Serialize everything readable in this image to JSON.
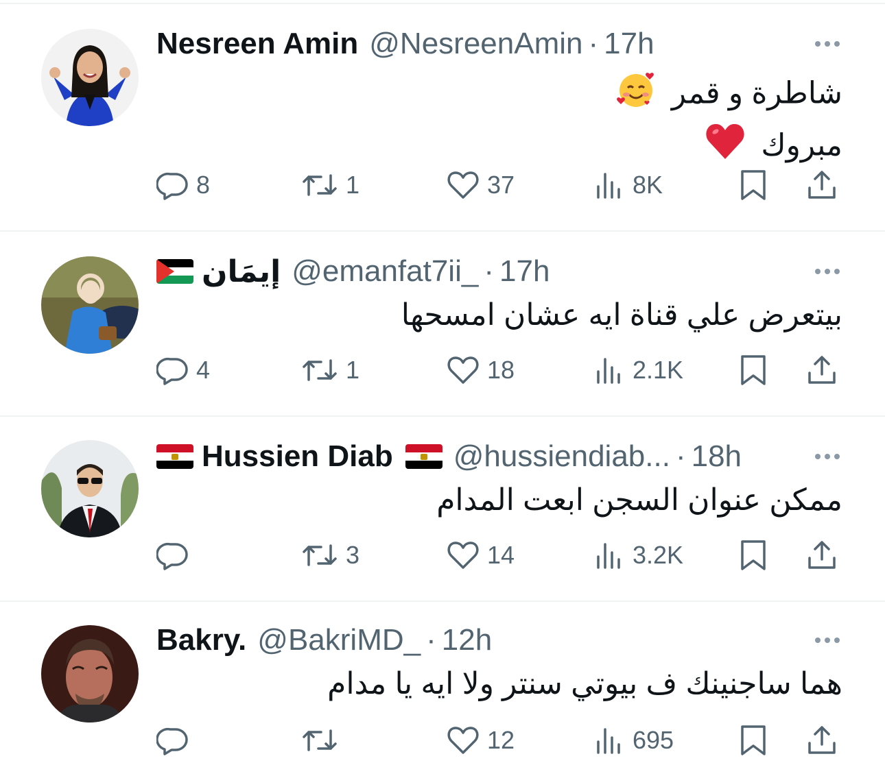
{
  "tweets": [
    {
      "display_name": "Nesreen Amin",
      "handle": "@NesreenAmin",
      "time": "17h",
      "flags_before": [],
      "flags_after": [],
      "lines": [
        "شاطرة و قمر",
        "مبروك"
      ],
      "line_emojis": [
        "smiling-face-with-hearts",
        "red-heart"
      ],
      "replies": "8",
      "reposts": "1",
      "likes": "37",
      "views": "8K"
    },
    {
      "display_name": "إيمَان",
      "handle": "@emanfat7ii_",
      "time": "17h",
      "flags_before": [
        "palestine"
      ],
      "flags_after": [],
      "lines": [
        "بيتعرض علي قناة ايه عشان امسحها"
      ],
      "line_emojis": [],
      "replies": "4",
      "reposts": "1",
      "likes": "18",
      "views": "2.1K"
    },
    {
      "display_name": "Hussien Diab",
      "handle": "@hussiendiab...",
      "time": "18h",
      "flags_before": [
        "egypt"
      ],
      "flags_after": [
        "egypt"
      ],
      "lines": [
        "ممكن عنوان السجن ابعت المدام"
      ],
      "line_emojis": [],
      "replies": "",
      "reposts": "3",
      "likes": "14",
      "views": "3.2K"
    },
    {
      "display_name": "Bakry.",
      "handle": "@BakriMD_",
      "time": "12h",
      "flags_before": [],
      "flags_after": [],
      "lines": [
        "هما ساجنينك ف بيوتي سنتر ولا ايه يا مدام"
      ],
      "line_emojis": [],
      "replies": "",
      "reposts": "",
      "likes": "12",
      "views": "695"
    }
  ],
  "separator": "·",
  "colors": {
    "text": "#0f1419",
    "secondary": "#536471",
    "divider": "#eff3f4",
    "heart_emoji": "#e0243c"
  }
}
